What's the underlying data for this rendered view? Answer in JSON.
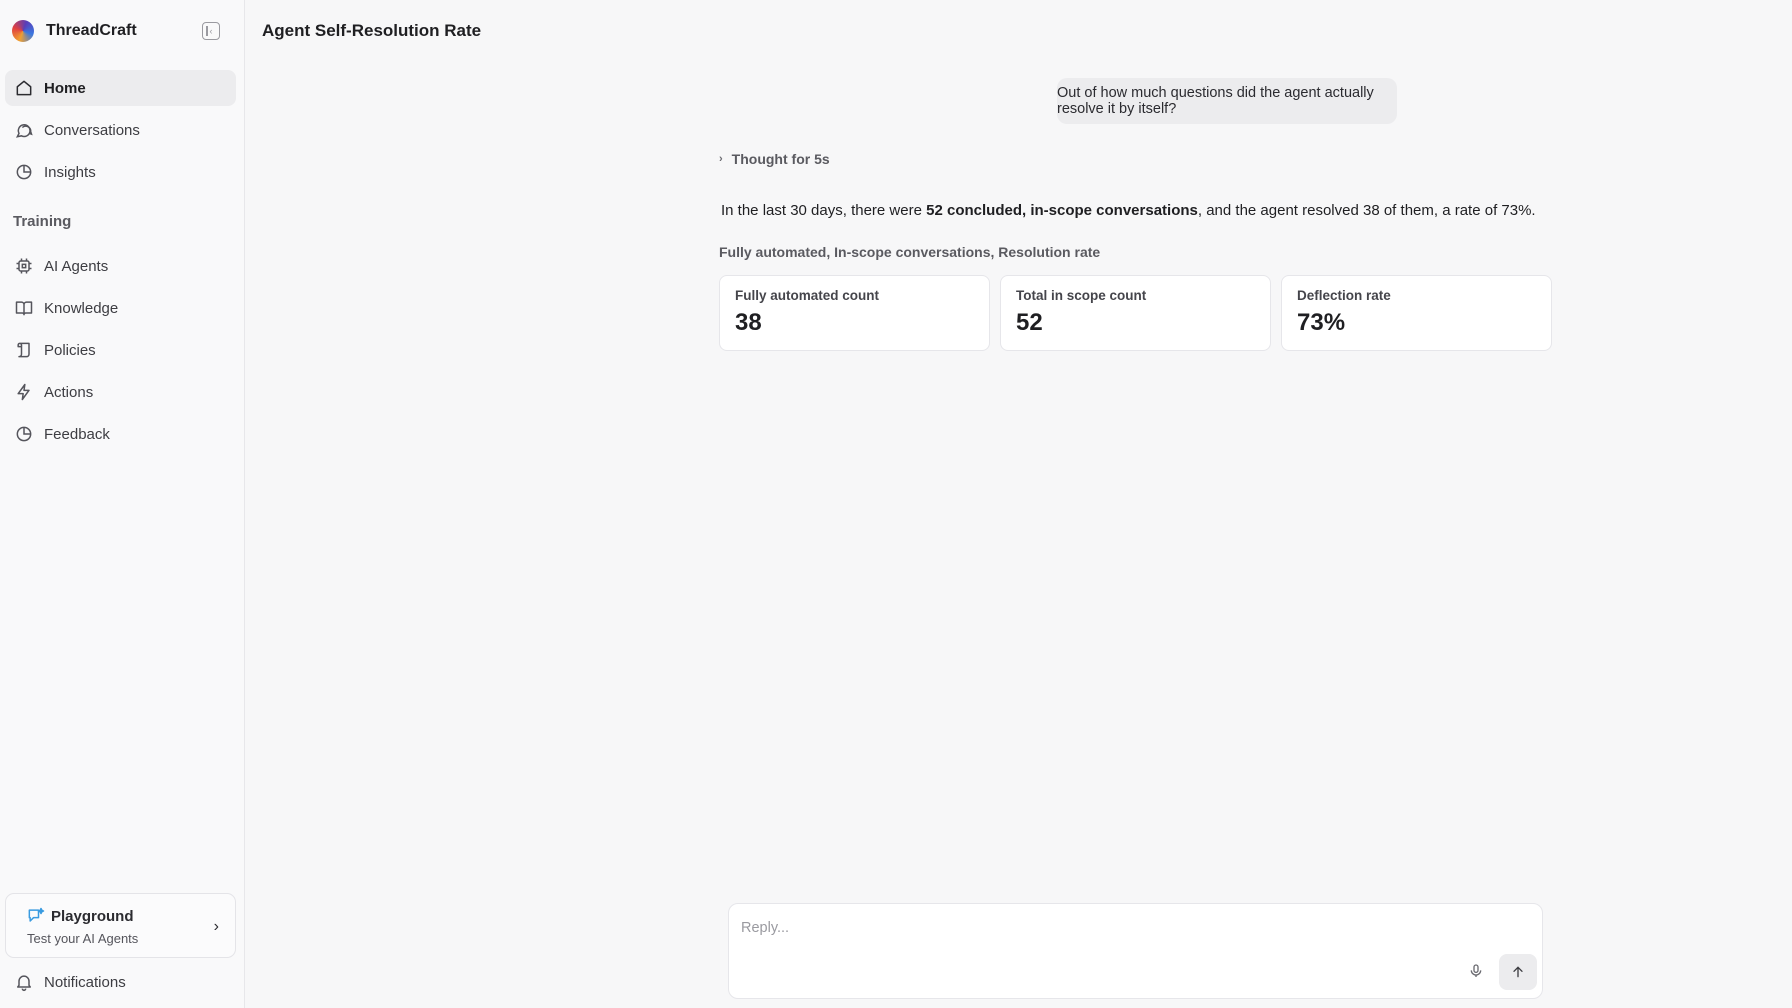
{
  "brand": {
    "name": "ThreadCraft"
  },
  "sidebar": {
    "items": [
      {
        "label": "Home",
        "icon": "home-icon",
        "active": true
      },
      {
        "label": "Conversations",
        "icon": "chat-icon"
      },
      {
        "label": "Insights",
        "icon": "pie-chart-icon"
      }
    ],
    "section_label": "Training",
    "training_items": [
      {
        "label": "AI Agents",
        "icon": "cpu-icon"
      },
      {
        "label": "Knowledge",
        "icon": "book-icon"
      },
      {
        "label": "Policies",
        "icon": "scroll-icon"
      },
      {
        "label": "Actions",
        "icon": "lightning-icon"
      },
      {
        "label": "Feedback",
        "icon": "pie-chart-icon"
      }
    ],
    "playground": {
      "title": "Playground",
      "subtitle": "Test your AI Agents"
    },
    "notifications": {
      "label": "Notifications",
      "icon": "bell-icon"
    }
  },
  "main": {
    "title": "Agent Self-Resolution Rate",
    "user_message": "Out of how much questions did the agent actually resolve it by itself?",
    "thought_label": "Thought for 5s",
    "answer": {
      "prefix": "In the last 30 days, there were ",
      "bold": "52 concluded, in-scope conversations",
      "suffix": ", and the agent resolved 38 of them, a rate of 73%."
    },
    "metrics_label": "Fully automated, In-scope conversations, Resolution rate",
    "cards": [
      {
        "label": "Fully automated count",
        "value": "38"
      },
      {
        "label": "Total in scope count",
        "value": "52"
      },
      {
        "label": "Deflection rate",
        "value": "73%"
      }
    ],
    "reply": {
      "placeholder": "Reply...",
      "value": ""
    }
  },
  "colors": {
    "accent": "#1f1f22",
    "active_bg": "#ececee",
    "playground_icon": "#3a9be0"
  }
}
